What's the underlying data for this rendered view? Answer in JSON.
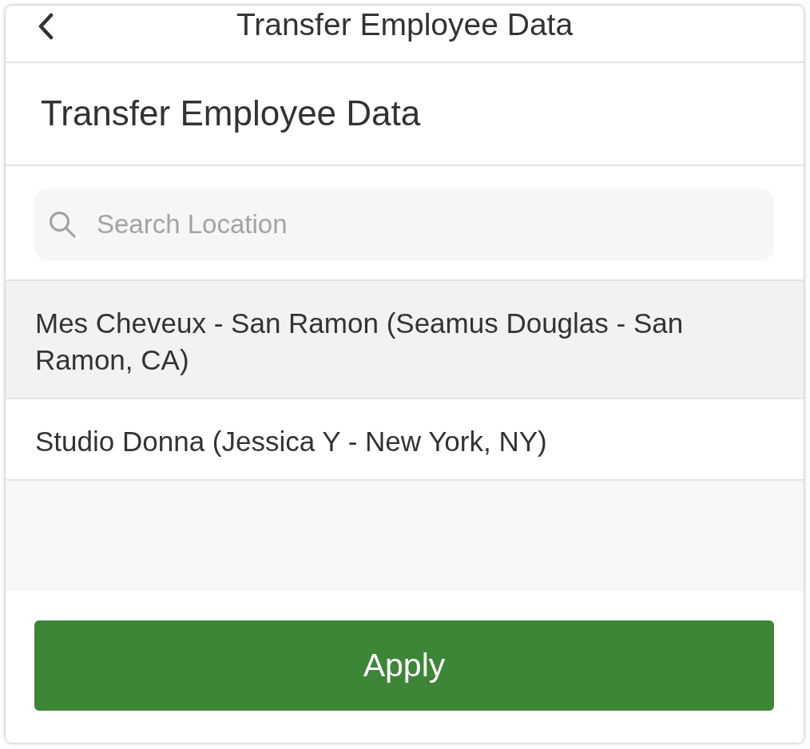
{
  "header": {
    "title": "Transfer Employee Data"
  },
  "heading": "Transfer Employee Data",
  "search": {
    "placeholder": "Search Location"
  },
  "locations": [
    {
      "label": "Mes Cheveux - San Ramon (Seamus Douglas - San Ramon, CA)",
      "selected": true
    },
    {
      "label": "Studio Donna (Jessica Y - New York, NY)",
      "selected": false
    }
  ],
  "buttons": [
    "Apply"
  ]
}
